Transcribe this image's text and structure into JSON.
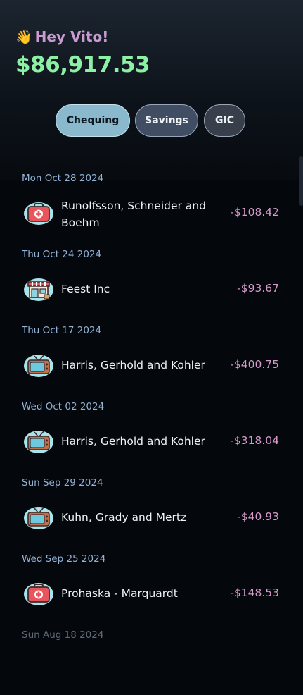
{
  "header": {
    "wave_emoji": "👋",
    "greeting": "Hey Vito!",
    "balance": "$86,917.53"
  },
  "tabs": [
    {
      "label": "Chequing",
      "active": true
    },
    {
      "label": "Savings",
      "active": false
    },
    {
      "label": "GIC",
      "active": false
    }
  ],
  "transactions": [
    {
      "date": "Mon Oct 28 2024",
      "name": "Runolfsson, Schneider and Boehm",
      "amount": "-$108.42",
      "icon": "medical-kit-icon"
    },
    {
      "date": "Thu Oct 24 2024",
      "name": "Feest Inc",
      "amount": "-$93.67",
      "icon": "storefront-icon"
    },
    {
      "date": "Thu Oct 17 2024",
      "name": "Harris, Gerhold and Kohler",
      "amount": "-$400.75",
      "icon": "television-icon"
    },
    {
      "date": "Wed Oct 02 2024",
      "name": "Harris, Gerhold and Kohler",
      "amount": "-$318.04",
      "icon": "television-icon"
    },
    {
      "date": "Sun Sep 29 2024",
      "name": "Kuhn, Grady and Mertz",
      "amount": "-$40.93",
      "icon": "television-icon"
    },
    {
      "date": "Wed Sep 25 2024",
      "name": "Prohaska - Marquardt",
      "amount": "-$148.53",
      "icon": "medical-kit-icon"
    },
    {
      "date": "Sun Aug 18 2024"
    }
  ],
  "colors": {
    "greeting": "#c99bd1",
    "balance": "#8cf0a5",
    "date": "#92b2d6",
    "amount": "#d49ac8",
    "tab_active": "#8ab8cc"
  }
}
